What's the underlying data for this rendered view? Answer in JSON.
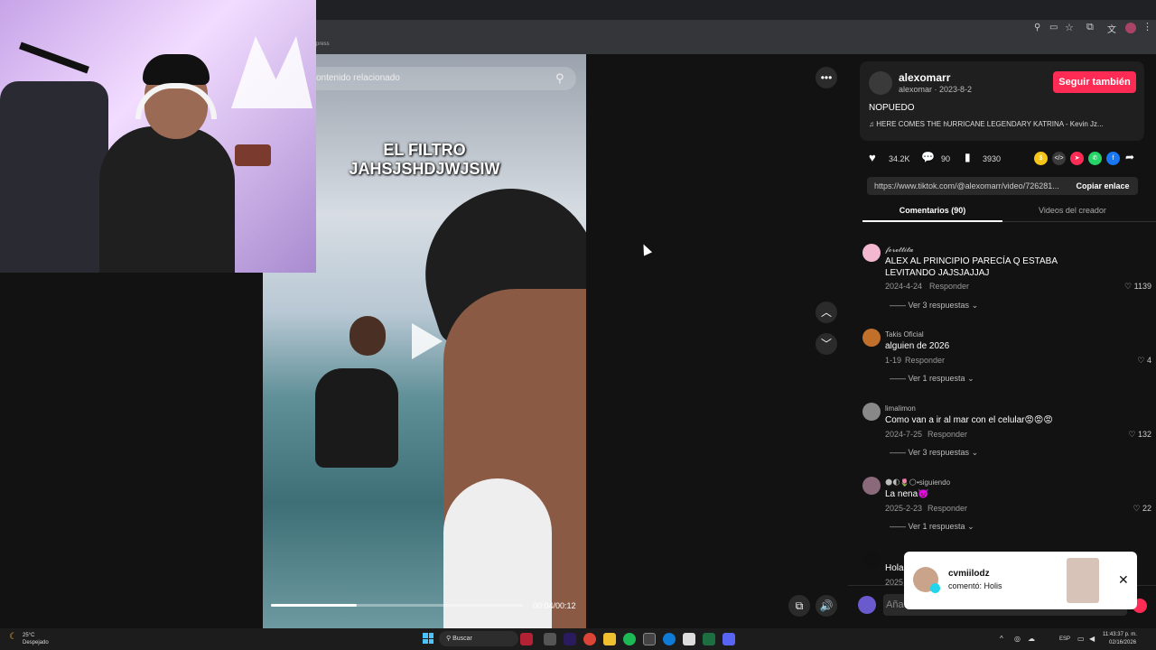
{
  "browser": {
    "bookmark_label": "press"
  },
  "video": {
    "search_placeholder": "ontenido relacionado",
    "overlay_line1": "EL FILTRO",
    "overlay_line2": "JAHSJSHDJWJSIW",
    "time": "00:04/00:12",
    "progress": 0.34
  },
  "author": {
    "display_name": "alexomarr",
    "handle_date": "alexomar · 2023-8-2",
    "follow_label": "Seguir también",
    "caption": "NOPUEDO",
    "music": "HERE COMES THE hURRICANE LEGENDARY KATRINA - Kevin Jz..."
  },
  "stats": {
    "likes": "34.2K",
    "comments": "90",
    "saves": "3930"
  },
  "share": {
    "url": "https://www.tiktok.com/@alexomarr/video/726281...",
    "copy_label": "Copiar enlace"
  },
  "tabs": {
    "comments": "Comentarios (90)",
    "creator_videos": "Videos del creador"
  },
  "comments": [
    {
      "user": "𝓯𝓸𝓻𝓮𝓽𝓽𝓲𝓽𝓪",
      "text": "ALEX AL PRINCIPIO PARECÍA Q ESTABA LEVITANDO JAJSJAJJAJ",
      "date": "2024-4-24",
      "reply": "Responder",
      "likes": "1139",
      "replies": "Ver 3 respuestas"
    },
    {
      "user": "Takis Oficial",
      "text": "alguien de 2026",
      "date": "1-19",
      "reply": "Responder",
      "likes": "4",
      "replies": "Ver 1 respuesta"
    },
    {
      "user": "limalimon",
      "text": "Como van a ir al mar con el celular😡😡😡",
      "date": "2024-7-25",
      "reply": "Responder",
      "likes": "132",
      "replies": "Ver 3 respuestas"
    },
    {
      "user": "🌑🌓🌷🌕•siguiendo",
      "text": "La nena👿",
      "date": "2025-2-23",
      "reply": "Responder",
      "likes": "22",
      "replies": "Ver 1 respuesta"
    },
    {
      "user": "",
      "text": "Hola",
      "date": "2025",
      "reply": "",
      "likes": "",
      "replies": ""
    }
  ],
  "comment_input": {
    "placeholder": "Aña"
  },
  "toast": {
    "user": "cvmiilodz",
    "message": "comentó: Holis"
  },
  "taskbar": {
    "weather_temp": "25°C",
    "weather_desc": "Despejado",
    "search_label": "Buscar",
    "lang": "ESP",
    "time": "11:43:37 p. m.",
    "date": "02/16/2026"
  },
  "colors": {
    "accent": "#fe2c55",
    "panel_bg": "#121212",
    "card_bg": "#1f1f1f"
  }
}
